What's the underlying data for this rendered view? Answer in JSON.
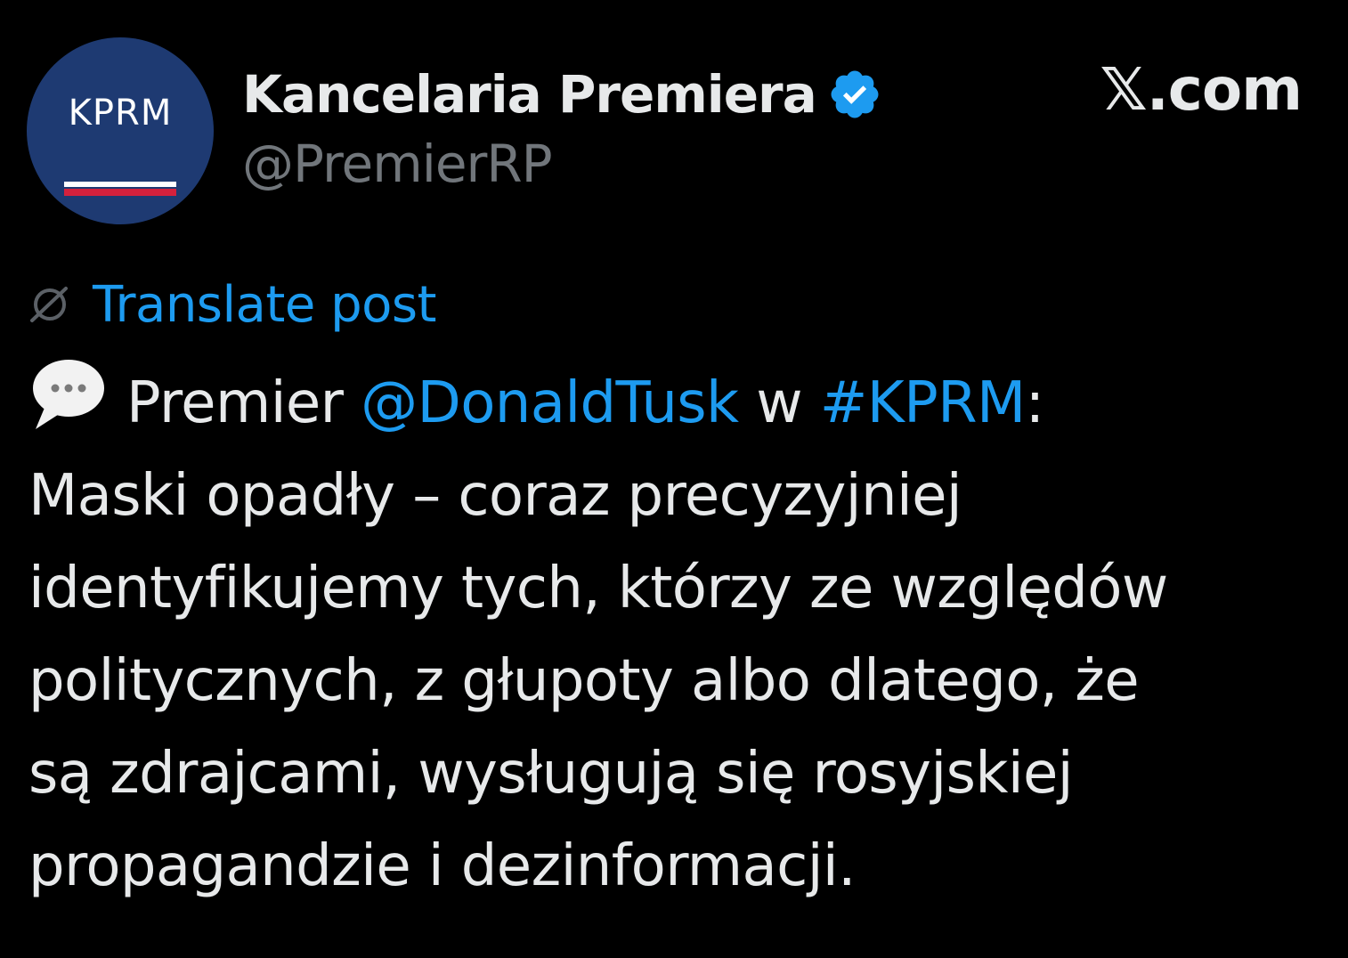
{
  "author": {
    "display_name": "Kancelaria Premiera",
    "handle": "@PremierRP",
    "avatar_text": "KPRM",
    "verified_icon": "verified-badge-icon",
    "verified_color": "#1d9bf0"
  },
  "site": {
    "label": "𝕏.com"
  },
  "translate": {
    "icon": "translate-globe-icon",
    "label": "Translate post"
  },
  "post": {
    "emoji_icon": "speech-balloon-icon",
    "intro_word": "Premier",
    "mention": "@DonaldTusk",
    "connector": "w",
    "hashtag": "#KPRM",
    "colon": ":",
    "lines": [
      "Maski opadły – coraz precyzyjniej",
      "identyfikujemy tych, którzy ze względów",
      "politycznych, z głupoty albo dlatego, że",
      "są zdrajcami, wysługują się rosyjskiej",
      "propagandzie i dezinformacji."
    ]
  },
  "colors": {
    "background": "#000000",
    "text": "#e7e9ea",
    "secondary_text": "#71767b",
    "link": "#1d9bf0",
    "avatar_bg": "#1e3a72",
    "flag_red": "#d4213d"
  }
}
